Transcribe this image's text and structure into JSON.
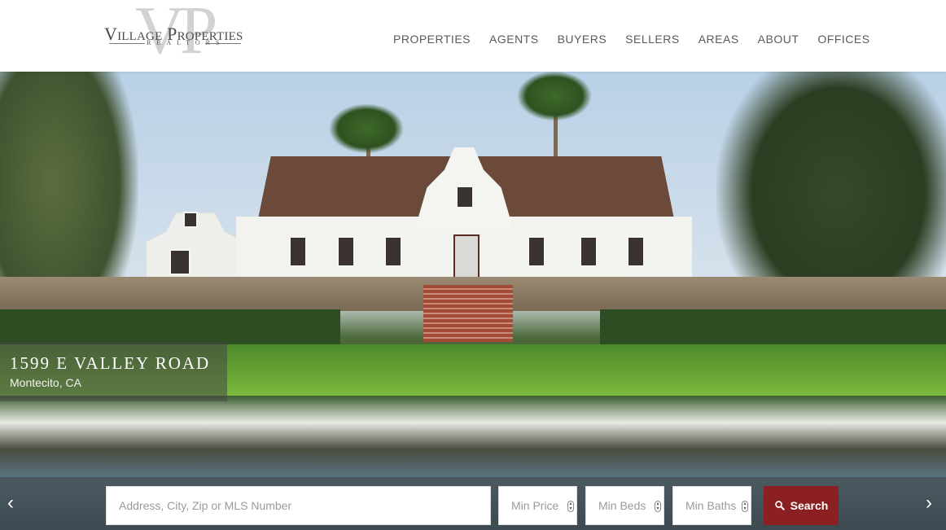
{
  "logo": {
    "name": "Village Properties",
    "monogram": "VP",
    "tagline": "REALTORS"
  },
  "nav": {
    "items": [
      "PROPERTIES",
      "AGENTS",
      "BUYERS",
      "SELLERS",
      "AREAS",
      "ABOUT",
      "OFFICES"
    ]
  },
  "hero": {
    "address": "1599 E VALLEY ROAD",
    "city": "Montecito, CA"
  },
  "search": {
    "address_placeholder": "Address, City, Zip or MLS Number",
    "min_price_placeholder": "Min Price",
    "min_beds_placeholder": "Min Beds",
    "min_baths_placeholder": "Min Baths",
    "button_label": "Search",
    "button_color": "#8c1f21"
  },
  "icons": {
    "prev": "chevron-left-icon",
    "next": "chevron-right-icon",
    "search": "search-icon"
  }
}
